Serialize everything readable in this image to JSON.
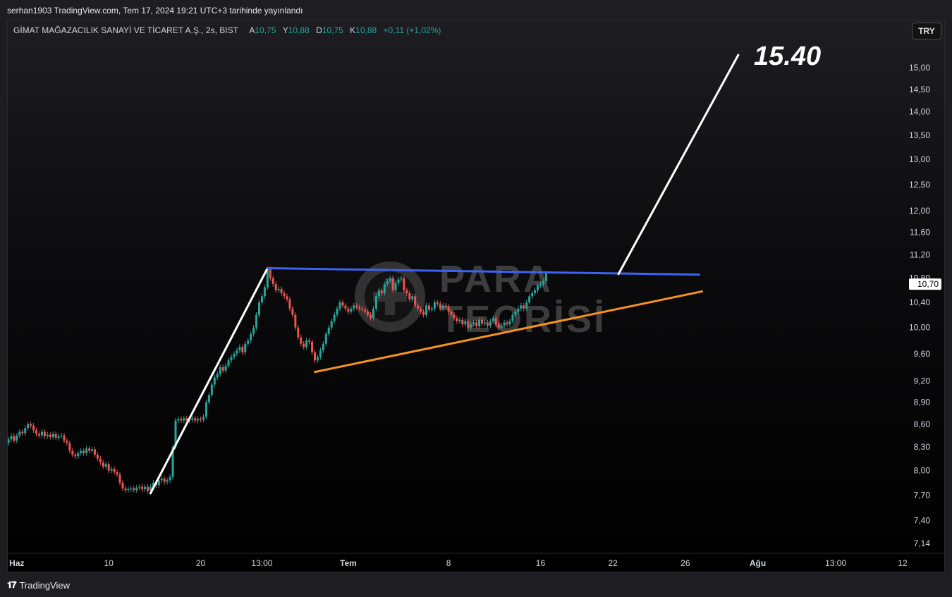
{
  "header": {
    "published": "serhan1903 TradingView.com, Tem 17, 2024 19:21 UTC+3 tarihinde yayınlandı"
  },
  "legend": {
    "symbol": "GİMAT MAĞAZACILIK SANAYİ VE TİCARET A.Ş., 2s, BIST",
    "open_label": "A",
    "open": "10,75",
    "high_label": "Y",
    "high": "10,88",
    "low_label": "D",
    "low": "10,75",
    "close_label": "K",
    "close": "10,88",
    "change": "+0,11 (+1,02%)"
  },
  "currency_button": "TRY",
  "footer": {
    "brand": "TradingView",
    "logo": "tv-logo-icon"
  },
  "watermark": {
    "line1": "PARA",
    "line2": "TEORİSİ",
    "logo": "para-teorisi-logo-icon"
  },
  "colors": {
    "up": "#26a69a",
    "down": "#ef5350",
    "resistance": "#3d63f2",
    "support": "#f7931a",
    "projection": "#ffffff",
    "axis_text": "#d1d4dc"
  },
  "chart_data": {
    "type": "candlestick",
    "title": "",
    "series_name": "",
    "y_ticks": [
      "15,00",
      "14,50",
      "14,00",
      "13,50",
      "13,00",
      "12,50",
      "12,00",
      "11,60",
      "11,20",
      "10,80",
      "10,40",
      "10,00",
      "9,60",
      "9,20",
      "8,90",
      "8,60",
      "8,30",
      "8,00",
      "7,70",
      "7,40",
      "7,14"
    ],
    "y_tick_values": [
      15.0,
      14.5,
      14.0,
      13.5,
      13.0,
      12.5,
      12.0,
      11.6,
      11.2,
      10.8,
      10.4,
      10.0,
      9.6,
      9.2,
      8.9,
      8.6,
      8.3,
      8.0,
      7.7,
      7.4,
      7.14
    ],
    "x_ticks": [
      "Haz",
      "10",
      "20",
      "13:00",
      "Tem",
      "8",
      "16",
      "22",
      "26",
      "Ağu",
      "13:00",
      "12"
    ],
    "x_tick_bold": [
      true,
      false,
      false,
      false,
      true,
      false,
      false,
      false,
      false,
      true,
      false,
      false
    ],
    "x_tick_t": [
      3,
      36,
      69,
      91,
      122,
      158,
      191,
      217,
      243,
      269,
      297,
      321
    ],
    "current_price": 10.7,
    "current_price_label": "10,70",
    "annotation": "15.40",
    "lines": [
      {
        "name": "uptrend",
        "color": "#ffffff",
        "t1": 51,
        "p1": 7.72,
        "t2": 93,
        "p2": 10.97
      },
      {
        "name": "resistance",
        "color": "#3d63f2",
        "t1": 93,
        "p1": 10.97,
        "t2": 248,
        "p2": 10.86
      },
      {
        "name": "support",
        "color": "#f7931a",
        "t1": 110,
        "p1": 9.33,
        "t2": 249,
        "p2": 10.58
      },
      {
        "name": "projection",
        "color": "#ffffff",
        "t1": 219,
        "p1": 10.87,
        "t2": 262,
        "p2": 15.3
      }
    ],
    "closes": [
      8.4,
      8.44,
      8.38,
      8.45,
      8.5,
      8.48,
      8.55,
      8.6,
      8.58,
      8.52,
      8.47,
      8.45,
      8.5,
      8.44,
      8.46,
      8.43,
      8.47,
      8.42,
      8.44,
      8.45,
      8.38,
      8.35,
      8.25,
      8.2,
      8.18,
      8.22,
      8.25,
      8.22,
      8.28,
      8.25,
      8.27,
      8.2,
      8.15,
      8.1,
      8.05,
      8.08,
      8.0,
      8.02,
      7.98,
      7.95,
      7.85,
      7.78,
      7.76,
      7.77,
      7.78,
      7.76,
      7.79,
      7.8,
      7.77,
      7.8,
      7.75,
      7.8,
      7.85,
      7.82,
      7.88,
      7.9,
      7.86,
      7.88,
      7.92,
      8.3,
      8.65,
      8.67,
      8.65,
      8.68,
      8.65,
      8.66,
      8.68,
      8.65,
      8.67,
      8.66,
      8.7,
      8.9,
      9.0,
      9.15,
      9.25,
      9.3,
      9.4,
      9.35,
      9.42,
      9.5,
      9.55,
      9.6,
      9.65,
      9.7,
      9.62,
      9.75,
      9.8,
      9.9,
      10.0,
      10.2,
      10.4,
      10.5,
      10.65,
      10.95,
      10.8,
      10.7,
      10.6,
      10.62,
      10.55,
      10.5,
      10.45,
      10.3,
      10.2,
      10.0,
      9.85,
      9.75,
      9.7,
      9.8,
      9.78,
      9.62,
      9.5,
      9.55,
      9.65,
      9.75,
      9.9,
      10.0,
      10.1,
      10.2,
      10.3,
      10.4,
      10.35,
      10.3,
      10.25,
      10.3,
      10.35,
      10.32,
      10.3,
      10.28,
      10.25,
      10.2,
      10.15,
      10.3,
      10.5,
      10.6,
      10.55,
      10.7,
      10.75,
      10.8,
      10.6,
      10.72,
      10.78,
      10.8,
      10.6,
      10.55,
      10.45,
      10.5,
      10.35,
      10.3,
      10.25,
      10.2,
      10.35,
      10.28,
      10.3,
      10.4,
      10.38,
      10.3,
      10.35,
      10.33,
      10.25,
      10.2,
      10.15,
      10.1,
      10.12,
      10.05,
      10.1,
      10.0,
      10.05,
      10.08,
      10.02,
      10.12,
      10.06,
      10.08,
      10.03,
      10.1,
      10.15,
      10.05,
      10.0,
      10.03,
      10.08,
      10.05,
      10.1,
      10.2,
      10.25,
      10.3,
      10.35,
      10.3,
      10.4,
      10.5,
      10.55,
      10.6,
      10.68,
      10.7,
      10.75,
      10.88
    ]
  }
}
